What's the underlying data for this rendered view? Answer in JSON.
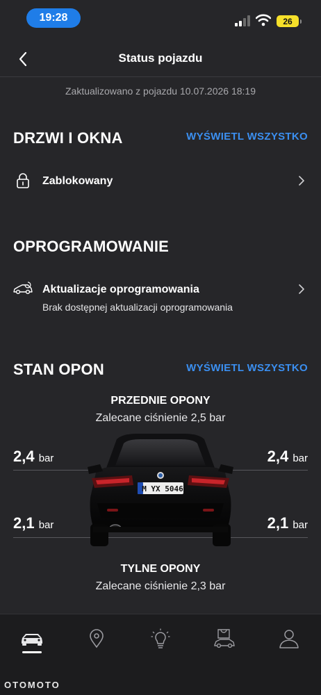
{
  "status_bar": {
    "time": "19:28",
    "battery": "26"
  },
  "header": {
    "title": "Status pojazdu"
  },
  "updated_text": "Zaktualizowano z pojazdu 10.07.2026 18:19",
  "doors": {
    "title": "DRZWI I OKNA",
    "view_all": "WYŚWIETL WSZYSTKO",
    "item_label": "Zablokowany"
  },
  "software": {
    "title": "OPROGRAMOWANIE",
    "item_label": "Aktualizacje oprogramowania",
    "item_sub": "Brak dostępnej aktualizacji oprogramowania"
  },
  "tires": {
    "title": "STAN OPON",
    "view_all": "WYŚWIETL WSZYSTKO",
    "front_title": "PRZEDNIE OPONY",
    "front_recommended": "Zalecane ciśnienie 2,5 bar",
    "rear_title": "TYLNE OPONY",
    "rear_recommended": "Zalecane ciśnienie 2,3 bar",
    "front_left": "2,4",
    "front_right": "2,4",
    "rear_left": "2,1",
    "rear_right": "2,1",
    "unit": "bar",
    "plate": "M YX 5046"
  },
  "nav": {
    "items": [
      "car-icon",
      "location-pin-icon",
      "lightbulb-icon",
      "shop-car-icon",
      "profile-icon"
    ],
    "active": "car-icon"
  },
  "watermark": "OTOMOTO",
  "colors": {
    "accent": "#3b8ff0",
    "background": "#262629",
    "time_pill": "#1f7de8",
    "battery": "#f6e02a"
  }
}
